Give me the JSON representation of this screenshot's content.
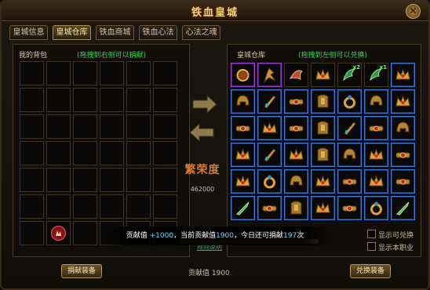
{
  "window": {
    "title": "铁血皇城"
  },
  "tabs": [
    {
      "label": "皇城信息",
      "active": false
    },
    {
      "label": "皇城仓库",
      "active": true
    },
    {
      "label": "铁血商城",
      "active": false
    },
    {
      "label": "铁血心法",
      "active": false
    },
    {
      "label": "心法之魂",
      "active": false
    }
  ],
  "backpack": {
    "title": "我的背包",
    "hint": "(拖拽到右侧可以捐献)"
  },
  "warehouse": {
    "title": "皇城仓库",
    "hint": "(拖拽到左侧可以兑换)"
  },
  "center": {
    "prosperity_label": "繁荣度",
    "prosperity_value": "462000"
  },
  "tooltip": {
    "p1": "贡献值 ",
    "v1": "+1000",
    "p2": "，当前贡献值",
    "v2": "1900",
    "p3": "，今日还可捐献",
    "v3": "197",
    "p4": "次"
  },
  "link": {
    "label": "规则说明"
  },
  "footer": {
    "donate_button": "捐献装备",
    "contribution": "贡献值 1900",
    "exchange_button": "兑换装备"
  },
  "checkboxes": {
    "show_exchangeable": "显示可兑换",
    "show_own_class": "显示本职业"
  },
  "warehouse_items": [
    {
      "icon": "amulet-icon",
      "rarity": "purple",
      "badge": ""
    },
    {
      "icon": "wing-pendant-icon",
      "rarity": "purple",
      "badge": ""
    },
    {
      "icon": "phoenix-talisman-icon",
      "rarity": "none",
      "badge": ""
    },
    {
      "icon": "crown-icon",
      "rarity": "none",
      "badge": ""
    },
    {
      "icon": "jade-dragon-icon",
      "rarity": "none",
      "badge": "x2"
    },
    {
      "icon": "jade-dragon-icon",
      "rarity": "none",
      "badge": "x1"
    },
    {
      "icon": "crown-icon",
      "rarity": "blue",
      "badge": ""
    },
    {
      "icon": "helmet-icon",
      "rarity": "blue",
      "badge": ""
    },
    {
      "icon": "blade-bracer-icon",
      "rarity": "blue",
      "badge": ""
    },
    {
      "icon": "gem-belt-icon",
      "rarity": "blue",
      "badge": ""
    },
    {
      "icon": "armor-icon",
      "rarity": "blue",
      "badge": ""
    },
    {
      "icon": "ring-icon",
      "rarity": "blue",
      "badge": ""
    },
    {
      "icon": "helmet-icon",
      "rarity": "blue",
      "badge": ""
    },
    {
      "icon": "crown-icon",
      "rarity": "blue",
      "badge": ""
    },
    {
      "icon": "gem-belt-icon",
      "rarity": "blue",
      "badge": ""
    },
    {
      "icon": "crown-icon",
      "rarity": "blue",
      "badge": ""
    },
    {
      "icon": "gem-belt-icon",
      "rarity": "blue",
      "badge": ""
    },
    {
      "icon": "armor-icon",
      "rarity": "blue",
      "badge": ""
    },
    {
      "icon": "blade-bracer-icon",
      "rarity": "blue",
      "badge": ""
    },
    {
      "icon": "gem-belt-icon",
      "rarity": "blue",
      "badge": ""
    },
    {
      "icon": "helmet-icon",
      "rarity": "blue",
      "badge": ""
    },
    {
      "icon": "crown-icon",
      "rarity": "blue",
      "badge": ""
    },
    {
      "icon": "blade-bracer-icon",
      "rarity": "blue",
      "badge": ""
    },
    {
      "icon": "crown-icon",
      "rarity": "blue",
      "badge": ""
    },
    {
      "icon": "armor-icon",
      "rarity": "blue",
      "badge": ""
    },
    {
      "icon": "helmet-icon",
      "rarity": "blue",
      "badge": ""
    },
    {
      "icon": "crown-icon",
      "rarity": "blue",
      "badge": ""
    },
    {
      "icon": "gem-belt-icon",
      "rarity": "blue",
      "badge": ""
    },
    {
      "icon": "crown-icon",
      "rarity": "blue",
      "badge": ""
    },
    {
      "icon": "ring-icon",
      "rarity": "blue",
      "badge": ""
    },
    {
      "icon": "helmet-icon",
      "rarity": "blue",
      "badge": ""
    },
    {
      "icon": "crown-icon",
      "rarity": "blue",
      "badge": ""
    },
    {
      "icon": "gem-belt-icon",
      "rarity": "blue",
      "badge": ""
    },
    {
      "icon": "crown-icon",
      "rarity": "blue",
      "badge": ""
    },
    {
      "icon": "gem-belt-icon",
      "rarity": "blue",
      "badge": ""
    },
    {
      "icon": "jade-sword-icon",
      "rarity": "blue",
      "badge": ""
    },
    {
      "icon": "gem-belt-icon",
      "rarity": "blue",
      "badge": ""
    },
    {
      "icon": "armor-icon",
      "rarity": "blue",
      "badge": ""
    },
    {
      "icon": "crown-icon",
      "rarity": "blue",
      "badge": ""
    },
    {
      "icon": "gem-belt-icon",
      "rarity": "blue",
      "badge": ""
    },
    {
      "icon": "ring-icon",
      "rarity": "blue",
      "badge": ""
    },
    {
      "icon": "jade-sword-icon",
      "rarity": "blue",
      "badge": ""
    }
  ],
  "backpack_items": [
    {
      "index": 37,
      "icon": "hand-cursor-icon"
    }
  ],
  "colors": {
    "gold": "#f1d27c",
    "green_hint": "#33d54e",
    "blue_frame": "#3d76d1",
    "purple_frame": "#9a42d4",
    "highlight": "#6ad7ff",
    "prosperity": "#d37a2d"
  }
}
